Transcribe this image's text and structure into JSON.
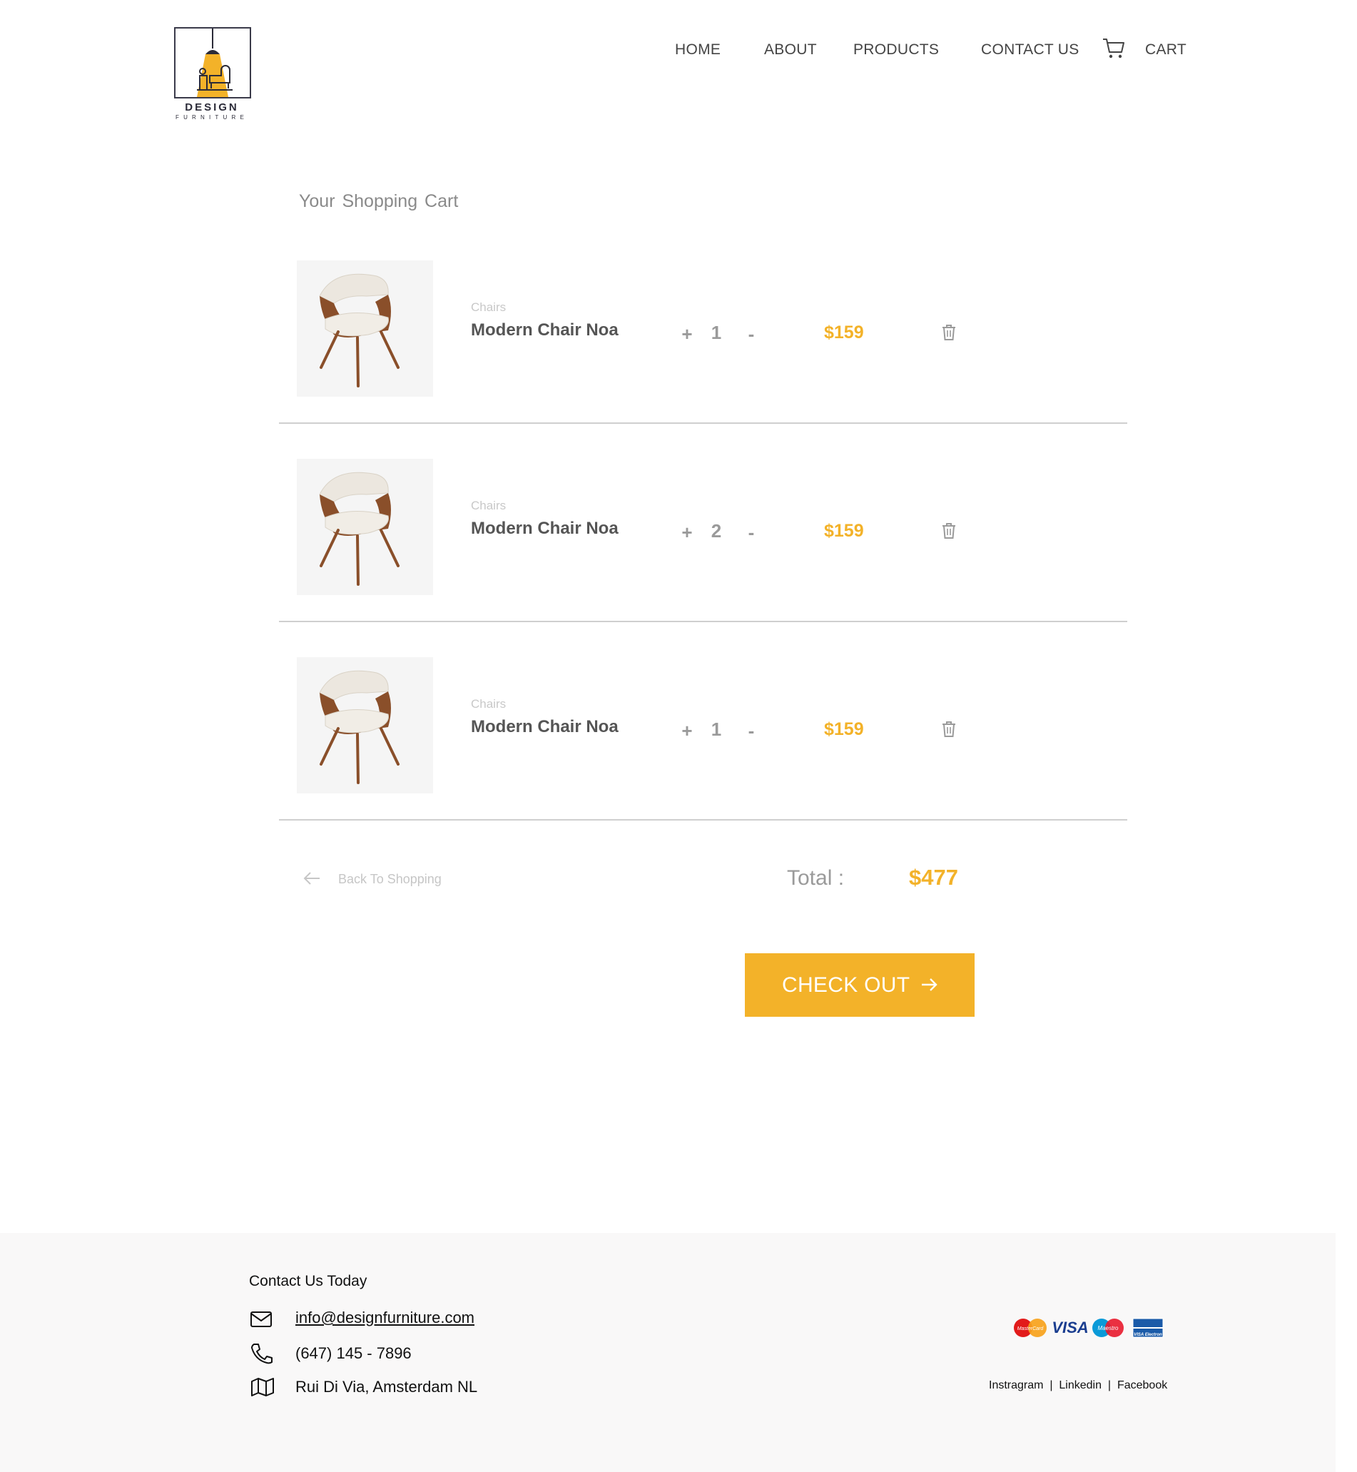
{
  "brand": {
    "name": "DESIGN",
    "subtitle": "FURNITURE",
    "accent_color": "#f3b229"
  },
  "nav": {
    "home": "HOME",
    "about": "ABOUT",
    "products": "PRODUCTS",
    "contact": "CONTACT  US",
    "cart": "CART",
    "cart_icon": "shopping-cart-icon"
  },
  "cart": {
    "title": "Your Shopping  Cart",
    "items": [
      {
        "category": "Chairs",
        "name": "Modern Chair Noa",
        "quantity": "1",
        "price": "$159"
      },
      {
        "category": "Chairs",
        "name": "Modern Chair Noa",
        "quantity": "2",
        "price": "$159"
      },
      {
        "category": "Chairs",
        "name": "Modern Chair Noa",
        "quantity": "1",
        "price": "$159"
      }
    ],
    "plus_label": "+",
    "minus_label": "-",
    "delete_icon": "trash-icon",
    "back_label": "Back To Shopping",
    "total_label": "Total :",
    "total_value": "$477",
    "checkout_label": "CHECK OUT"
  },
  "footer": {
    "title": "Contact Us Today",
    "email": "info@designfurniture.com",
    "phone": "(647) 145 - 7896",
    "address": "Rui Di Via, Amsterdam NL",
    "payment_cards": [
      "MasterCard",
      "VISA",
      "Maestro",
      "VISA Electron"
    ],
    "social": [
      "Instragram",
      "Linkedin",
      "Facebook"
    ],
    "social_separator": "|"
  }
}
